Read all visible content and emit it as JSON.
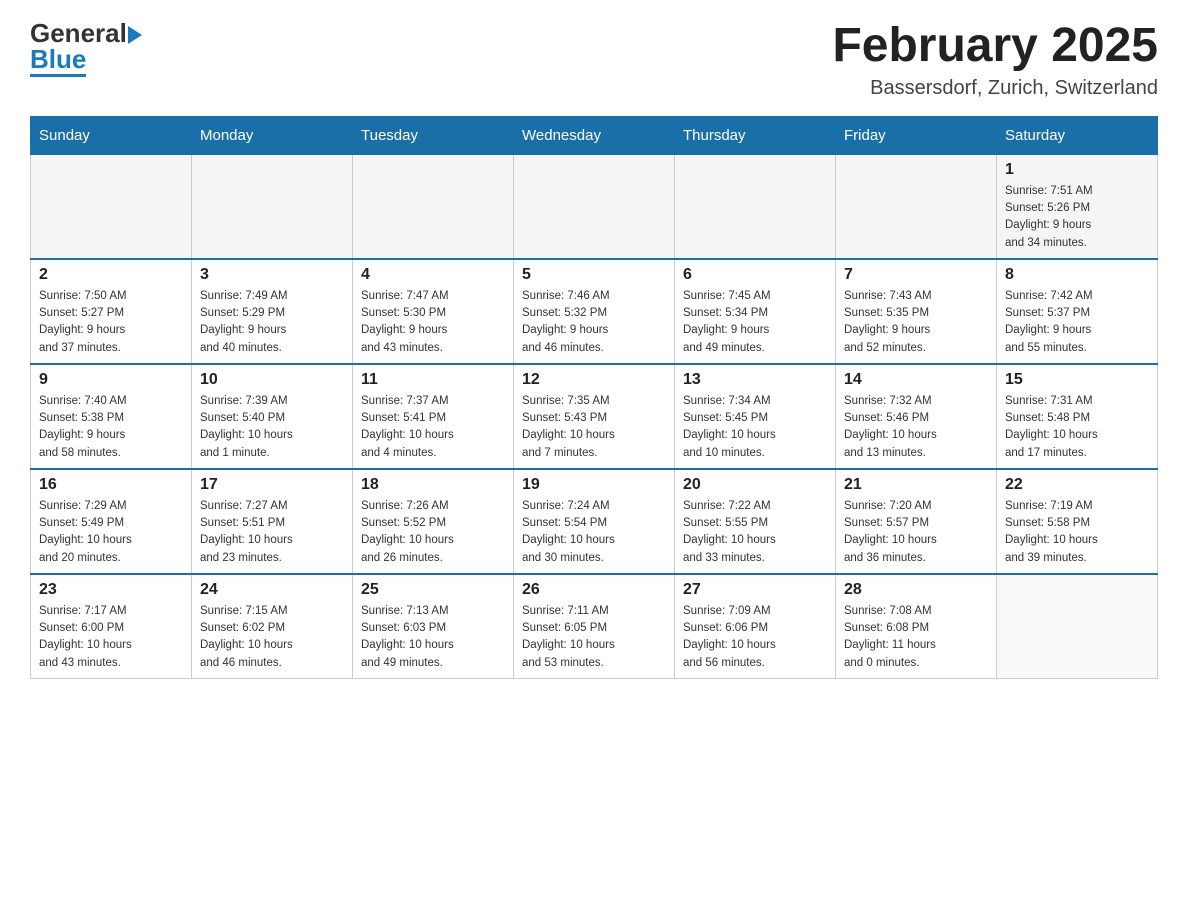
{
  "header": {
    "logo_line1": "General",
    "logo_line2": "Blue",
    "month_title": "February 2025",
    "location": "Bassersdorf, Zurich, Switzerland"
  },
  "weekdays": [
    "Sunday",
    "Monday",
    "Tuesday",
    "Wednesday",
    "Thursday",
    "Friday",
    "Saturday"
  ],
  "weeks": [
    {
      "days": [
        {
          "number": "",
          "info": ""
        },
        {
          "number": "",
          "info": ""
        },
        {
          "number": "",
          "info": ""
        },
        {
          "number": "",
          "info": ""
        },
        {
          "number": "",
          "info": ""
        },
        {
          "number": "",
          "info": ""
        },
        {
          "number": "1",
          "info": "Sunrise: 7:51 AM\nSunset: 5:26 PM\nDaylight: 9 hours\nand 34 minutes."
        }
      ]
    },
    {
      "days": [
        {
          "number": "2",
          "info": "Sunrise: 7:50 AM\nSunset: 5:27 PM\nDaylight: 9 hours\nand 37 minutes."
        },
        {
          "number": "3",
          "info": "Sunrise: 7:49 AM\nSunset: 5:29 PM\nDaylight: 9 hours\nand 40 minutes."
        },
        {
          "number": "4",
          "info": "Sunrise: 7:47 AM\nSunset: 5:30 PM\nDaylight: 9 hours\nand 43 minutes."
        },
        {
          "number": "5",
          "info": "Sunrise: 7:46 AM\nSunset: 5:32 PM\nDaylight: 9 hours\nand 46 minutes."
        },
        {
          "number": "6",
          "info": "Sunrise: 7:45 AM\nSunset: 5:34 PM\nDaylight: 9 hours\nand 49 minutes."
        },
        {
          "number": "7",
          "info": "Sunrise: 7:43 AM\nSunset: 5:35 PM\nDaylight: 9 hours\nand 52 minutes."
        },
        {
          "number": "8",
          "info": "Sunrise: 7:42 AM\nSunset: 5:37 PM\nDaylight: 9 hours\nand 55 minutes."
        }
      ]
    },
    {
      "days": [
        {
          "number": "9",
          "info": "Sunrise: 7:40 AM\nSunset: 5:38 PM\nDaylight: 9 hours\nand 58 minutes."
        },
        {
          "number": "10",
          "info": "Sunrise: 7:39 AM\nSunset: 5:40 PM\nDaylight: 10 hours\nand 1 minute."
        },
        {
          "number": "11",
          "info": "Sunrise: 7:37 AM\nSunset: 5:41 PM\nDaylight: 10 hours\nand 4 minutes."
        },
        {
          "number": "12",
          "info": "Sunrise: 7:35 AM\nSunset: 5:43 PM\nDaylight: 10 hours\nand 7 minutes."
        },
        {
          "number": "13",
          "info": "Sunrise: 7:34 AM\nSunset: 5:45 PM\nDaylight: 10 hours\nand 10 minutes."
        },
        {
          "number": "14",
          "info": "Sunrise: 7:32 AM\nSunset: 5:46 PM\nDaylight: 10 hours\nand 13 minutes."
        },
        {
          "number": "15",
          "info": "Sunrise: 7:31 AM\nSunset: 5:48 PM\nDaylight: 10 hours\nand 17 minutes."
        }
      ]
    },
    {
      "days": [
        {
          "number": "16",
          "info": "Sunrise: 7:29 AM\nSunset: 5:49 PM\nDaylight: 10 hours\nand 20 minutes."
        },
        {
          "number": "17",
          "info": "Sunrise: 7:27 AM\nSunset: 5:51 PM\nDaylight: 10 hours\nand 23 minutes."
        },
        {
          "number": "18",
          "info": "Sunrise: 7:26 AM\nSunset: 5:52 PM\nDaylight: 10 hours\nand 26 minutes."
        },
        {
          "number": "19",
          "info": "Sunrise: 7:24 AM\nSunset: 5:54 PM\nDaylight: 10 hours\nand 30 minutes."
        },
        {
          "number": "20",
          "info": "Sunrise: 7:22 AM\nSunset: 5:55 PM\nDaylight: 10 hours\nand 33 minutes."
        },
        {
          "number": "21",
          "info": "Sunrise: 7:20 AM\nSunset: 5:57 PM\nDaylight: 10 hours\nand 36 minutes."
        },
        {
          "number": "22",
          "info": "Sunrise: 7:19 AM\nSunset: 5:58 PM\nDaylight: 10 hours\nand 39 minutes."
        }
      ]
    },
    {
      "days": [
        {
          "number": "23",
          "info": "Sunrise: 7:17 AM\nSunset: 6:00 PM\nDaylight: 10 hours\nand 43 minutes."
        },
        {
          "number": "24",
          "info": "Sunrise: 7:15 AM\nSunset: 6:02 PM\nDaylight: 10 hours\nand 46 minutes."
        },
        {
          "number": "25",
          "info": "Sunrise: 7:13 AM\nSunset: 6:03 PM\nDaylight: 10 hours\nand 49 minutes."
        },
        {
          "number": "26",
          "info": "Sunrise: 7:11 AM\nSunset: 6:05 PM\nDaylight: 10 hours\nand 53 minutes."
        },
        {
          "number": "27",
          "info": "Sunrise: 7:09 AM\nSunset: 6:06 PM\nDaylight: 10 hours\nand 56 minutes."
        },
        {
          "number": "28",
          "info": "Sunrise: 7:08 AM\nSunset: 6:08 PM\nDaylight: 11 hours\nand 0 minutes."
        },
        {
          "number": "",
          "info": ""
        }
      ]
    }
  ]
}
